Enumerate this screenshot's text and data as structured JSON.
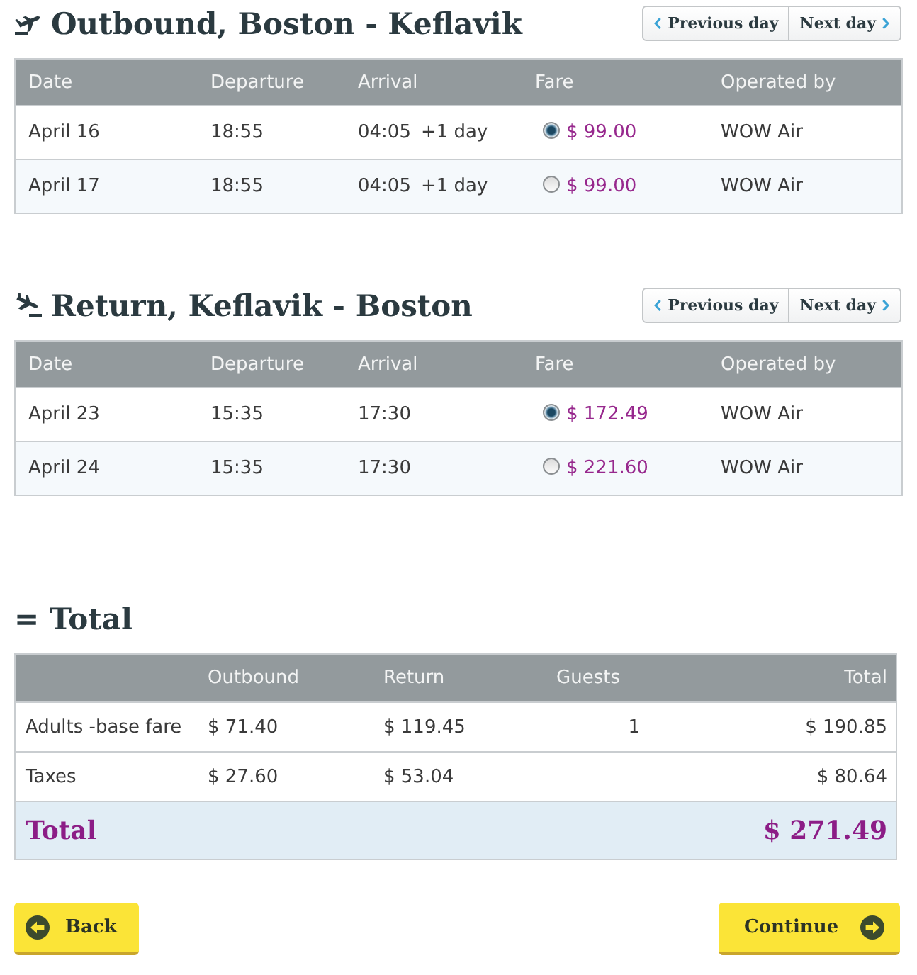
{
  "flights": [
    {
      "kind": "outbound",
      "title": "Outbound, Boston - Keflavik",
      "nav": [
        {
          "kind": "previous",
          "label": "Previous day"
        },
        {
          "kind": "next",
          "label": "Next day"
        }
      ],
      "columns": [
        "Date",
        "Departure",
        "Arrival",
        "Fare",
        "Operated by"
      ],
      "rows": [
        {
          "date": "April 16",
          "departure": "18:55",
          "arrival": "04:05",
          "arrival_note": "+1 day",
          "fare": "$ 99.00",
          "selected": true,
          "operator": "WOW Air"
        },
        {
          "date": "April 17",
          "departure": "18:55",
          "arrival": "04:05",
          "arrival_note": "+1 day",
          "fare": "$ 99.00",
          "selected": false,
          "operator": "WOW Air"
        }
      ]
    },
    {
      "kind": "return",
      "title": "Return, Keflavik - Boston",
      "nav": [
        {
          "kind": "previous",
          "label": "Previous day"
        },
        {
          "kind": "next",
          "label": "Next day"
        }
      ],
      "columns": [
        "Date",
        "Departure",
        "Arrival",
        "Fare",
        "Operated by"
      ],
      "rows": [
        {
          "date": "April 23",
          "departure": "15:35",
          "arrival": "17:30",
          "fare": "$ 172.49",
          "selected": true,
          "operator": "WOW Air"
        },
        {
          "date": "April 24",
          "departure": "15:35",
          "arrival": "17:30",
          "fare": "$ 221.60",
          "selected": false,
          "operator": "WOW Air"
        }
      ]
    }
  ],
  "total": {
    "title": "= Total",
    "columns": [
      "Outbound",
      "Return",
      "Guests",
      "Total"
    ],
    "rows": [
      {
        "label": "Adults -base fare",
        "outbound": "$ 71.40",
        "return": "$ 119.45",
        "guests": "1",
        "total": "$ 190.85"
      },
      {
        "label": "Taxes",
        "outbound": "$ 27.60",
        "return": "$ 53.04",
        "total": "$ 80.64"
      }
    ],
    "grand_total": {
      "label": "Total",
      "amount": "$ 271.49"
    }
  },
  "buttons": [
    {
      "kind": "back",
      "label": "Back"
    },
    {
      "kind": "continue",
      "label": "Continue"
    }
  ]
}
